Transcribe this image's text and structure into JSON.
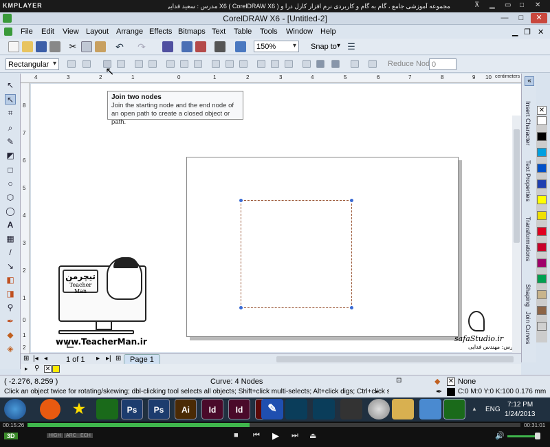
{
  "player": {
    "brand": "KMPLAYER",
    "title": "مجموعه آموزشی جامع ، گام به گام و کاربردی نرم افزار کارل درا و X6 ( CorelDRAW X6 ) مدرس : سعید فدایی ( تیچرمن ) گروه آموزشی پادشاه گرافیست ها",
    "time_elapsed": "00:15:26",
    "time_total": "00:31:01",
    "progress": 0.45,
    "btn_3d": "3D",
    "chips": [
      "HIGH",
      "ARC",
      "ECH"
    ]
  },
  "app": {
    "title": "CorelDRAW X6 - [Untitled-2]",
    "window_buttons": [
      "—",
      "□",
      "✕"
    ]
  },
  "menu": [
    "File",
    "Edit",
    "View",
    "Layout",
    "Arrange",
    "Effects",
    "Bitmaps",
    "Text",
    "Table",
    "Tools",
    "Window",
    "Help"
  ],
  "toolbar": {
    "zoom": "150%",
    "snap_to": "Snap to"
  },
  "property_bar": {
    "object_type": "Rectangular",
    "reduce_nodes_label": "Reduce Nodes",
    "reduce_nodes_value": "0"
  },
  "ruler": {
    "units": "centimeters",
    "h_ticks": [
      "4",
      "3",
      "2",
      "1",
      "0",
      "1",
      "2",
      "3",
      "4",
      "5",
      "6",
      "7",
      "8",
      "9",
      "10"
    ],
    "v_ticks": [
      "8",
      "7",
      "6",
      "5",
      "4",
      "3",
      "2",
      "1",
      "0",
      "1",
      "2"
    ]
  },
  "tooltip": {
    "title": "Join two nodes",
    "body": "Join the starting node and the end node of an open path to create a closed object or path."
  },
  "watermark_left": {
    "brand_fa": "تیچرمن",
    "brand_en": "Teacher Man",
    "url": "www.TeacherMan.ir"
  },
  "watermark_right": {
    "site": "safaStudio.ir",
    "credit_fa": "مدرس: مهندس فدایی"
  },
  "dockers": [
    "Insert Character",
    "Text Properties",
    "Transformations",
    "Shaping",
    "Join Curves"
  ],
  "palette_colors": [
    "#ffffff",
    "#000000",
    "#00a0e0",
    "#0050c8",
    "#1e3fb0",
    "#ffff00",
    "#f0e000",
    "#e00020",
    "#c8002a",
    "#a0006a",
    "#00a050",
    "#c8b48c",
    "#8c6446",
    "#d0d0d0"
  ],
  "navigation": {
    "page_count": "1 of 1",
    "page_tab": "Page 1"
  },
  "status": {
    "coords": "( -2.276, 8.259 )",
    "object_info": "Curve: 4 Nodes",
    "hint": "Click an object twice for rotating/skewing; dbl-clicking tool selects all objects; Shift+click multi-selects; Alt+click digs; Ctrl+click selects in a group",
    "fill": "None",
    "outline": "C:0 M:0 Y:0 K:100  0.176 mm"
  },
  "taskbar": {
    "lang": "ENG",
    "time": "7:12 PM",
    "date": "1/24/2013",
    "apps": [
      {
        "label": "Ps",
        "color": "#1c3c6e"
      },
      {
        "label": "Ps",
        "color": "#1c3c6e"
      },
      {
        "label": "Ai",
        "color": "#4a2a05"
      },
      {
        "label": "Id",
        "color": "#4a0a2a"
      },
      {
        "label": "Id",
        "color": "#4a0a2a"
      },
      {
        "label": "Fl",
        "color": "#5a0a0a"
      }
    ]
  }
}
